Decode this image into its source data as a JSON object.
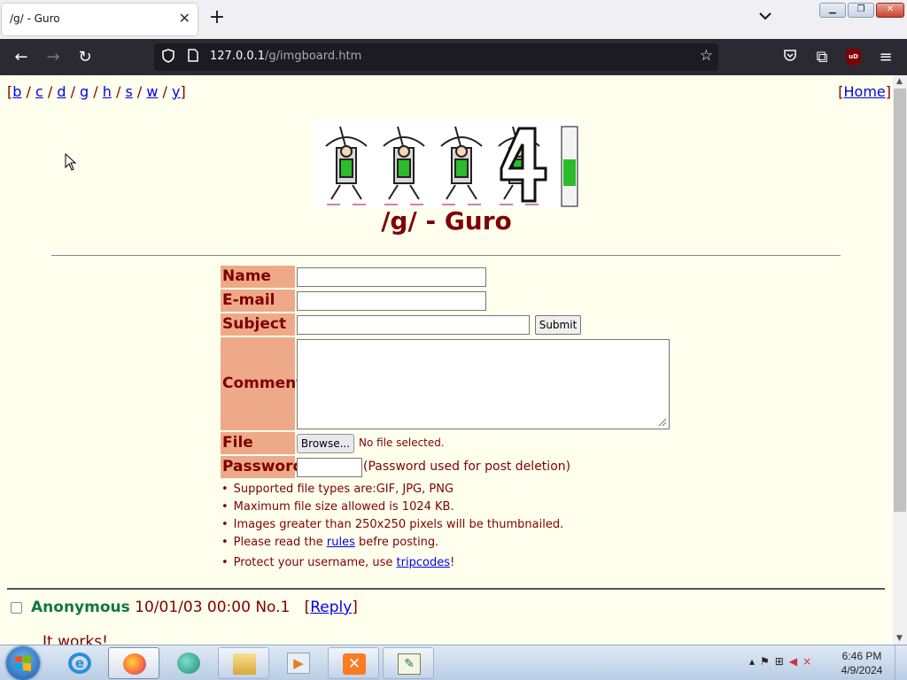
{
  "browser": {
    "tab_title": "/g/ - Guro",
    "tab_close": "✕",
    "new_tab": "+",
    "url_host": "127.0.0.1",
    "url_path": "/g/imgboard.htm",
    "ublock_label": "uD"
  },
  "board": {
    "nav_links": [
      "b",
      "c",
      "d",
      "g",
      "h",
      "s",
      "w",
      "y"
    ],
    "home_label": "Home",
    "title": "/g/ - Guro"
  },
  "form": {
    "name_label": "Name",
    "email_label": "E-mail",
    "subject_label": "Subject",
    "submit_label": "Submit",
    "comment_label": "Comment",
    "file_label": "File",
    "browse_label": "Browse...",
    "no_file": "No file selected.",
    "password_label": "Password",
    "password_note": "(Password used for post deletion)"
  },
  "rules": {
    "filetypes": "Supported file types are:GIF, JPG, PNG",
    "maxsize": "Maximum file size allowed is 1024 KB.",
    "thumb": "Images greater than 250x250 pixels will be thumbnailed.",
    "rules_pre": "Please read the ",
    "rules_link": "rules",
    "rules_post": " befre posting.",
    "trip_pre": "Protect your username, use ",
    "trip_link": "tripcodes",
    "trip_post": "!"
  },
  "post": {
    "name": "Anonymous",
    "datetime": "10/01/03 00:00",
    "number": "No.1",
    "reply_label": "Reply",
    "body": "It works!"
  },
  "taskbar": {
    "time": "6:46 PM",
    "date": "4/9/2024"
  }
}
